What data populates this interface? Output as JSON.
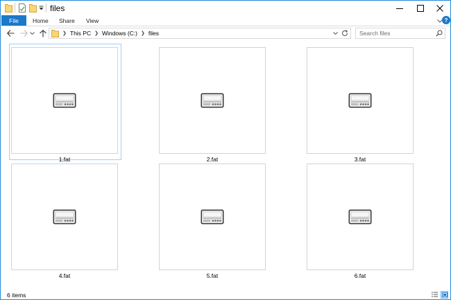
{
  "window": {
    "title": "files",
    "controls": [
      "minimize",
      "maximize",
      "close"
    ]
  },
  "ribbon": {
    "file_tab": "File",
    "tabs": [
      "Home",
      "Share",
      "View"
    ],
    "help": "?"
  },
  "navigation": {
    "breadcrumb": [
      "This PC",
      "Windows (C:)",
      "files"
    ]
  },
  "search": {
    "placeholder": "Search files"
  },
  "files": [
    {
      "name": "1.fat",
      "selected": true
    },
    {
      "name": "2.fat",
      "selected": false
    },
    {
      "name": "3.fat",
      "selected": false
    },
    {
      "name": "4.fat",
      "selected": false
    },
    {
      "name": "5.fat",
      "selected": false
    },
    {
      "name": "6.fat",
      "selected": false
    }
  ],
  "status": {
    "item_count": "6 items"
  },
  "colors": {
    "accent": "#1979ca",
    "selection_border": "#99d1ff",
    "window_border": "#1e8ad7"
  },
  "icons": {
    "file_type": "drive-device-icon"
  }
}
